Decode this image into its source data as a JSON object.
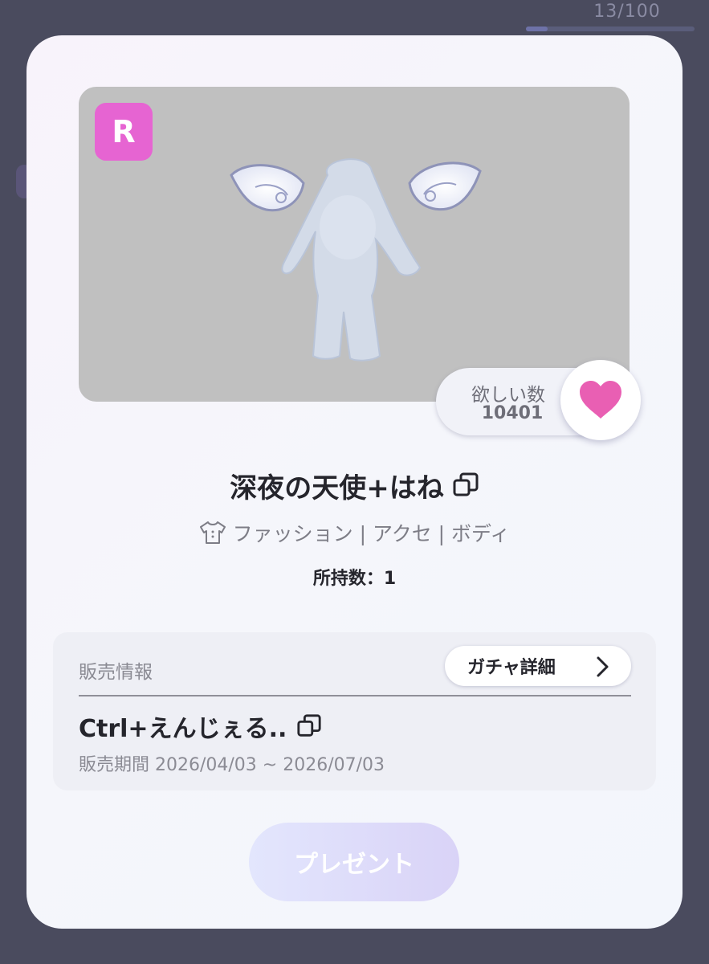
{
  "background": {
    "progress_text": "13/100",
    "progress_fraction": 0.13
  },
  "item": {
    "rarity": "R",
    "wish_label": "欲しい数",
    "wish_count": "10401",
    "name": "深夜の天使+はね",
    "category": "ファッション | アクセ | ボディ",
    "owned": "所持数：1"
  },
  "sales": {
    "header": "販売情報",
    "gacha_button": "ガチャ詳細",
    "gacha_name": "Ctrl+えんじぇる..",
    "period": "販売期間 2026/04/03 ~ 2026/07/03"
  },
  "actions": {
    "present_label": "プレゼント"
  },
  "colors": {
    "rarity_badge": "#e664d2",
    "heart": "#e95fb3",
    "present_button": "#dcdcfb"
  },
  "icons": [
    "copy-icon",
    "shirt-icon",
    "heart-icon",
    "chevron-right-icon"
  ]
}
